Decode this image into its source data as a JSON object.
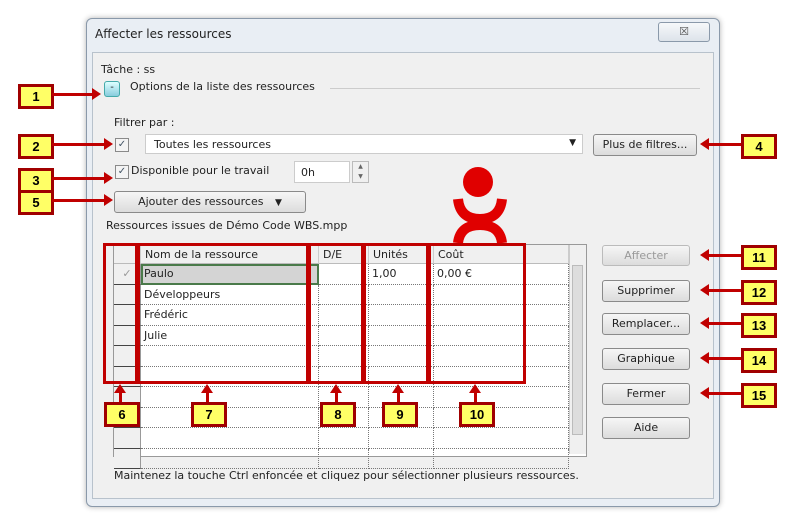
{
  "dialog": {
    "title": "Affecter les ressources",
    "close": "☒"
  },
  "task": "Tâche : ss",
  "options_label": "Options de la liste des ressources",
  "filter": {
    "label": "Filtrer par :",
    "value": "Toutes les ressources",
    "checked": true,
    "more_filters": "Plus de filtres..."
  },
  "available": {
    "label": "Disponible pour le travail",
    "checked": true,
    "value": "0h"
  },
  "add_resources": "Ajouter des ressources",
  "resources_from": "Ressources issues de Démo Code WBS.mpp",
  "table": {
    "columns": [
      "Nom de la ressource",
      "D/E",
      "Unités",
      "Coût"
    ],
    "rows": [
      {
        "check": "✓",
        "name": "Paulo",
        "de": "",
        "units": "1,00",
        "cost": "0,00 €"
      },
      {
        "check": "",
        "name": "Développeurs",
        "de": "",
        "units": "",
        "cost": ""
      },
      {
        "check": "",
        "name": "Frédéric",
        "de": "",
        "units": "",
        "cost": ""
      },
      {
        "check": "",
        "name": "Julie",
        "de": "",
        "units": "",
        "cost": ""
      }
    ]
  },
  "buttons": {
    "assign": "Affecter",
    "remove": "Supprimer",
    "replace": "Remplacer...",
    "graph": "Graphique",
    "close": "Fermer",
    "help": "Aide"
  },
  "hint": "Maintenez la touche Ctrl enfoncée et cliquez pour sélectionner plusieurs ressources.",
  "callouts": [
    "1",
    "2",
    "3",
    "4",
    "5",
    "6",
    "7",
    "8",
    "9",
    "10",
    "11",
    "12",
    "13",
    "14",
    "15"
  ],
  "colors": {
    "callout_border": "#a00000",
    "callout_fill": "#ffff66",
    "logo": "#e00000"
  }
}
